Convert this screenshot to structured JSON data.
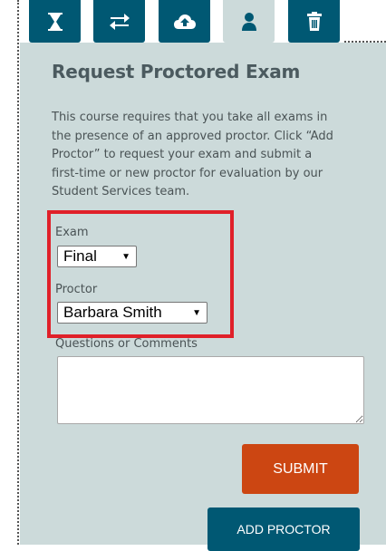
{
  "tabs": [
    {
      "icon": "hourglass-icon",
      "active": false
    },
    {
      "icon": "swap-arrows-icon",
      "active": false
    },
    {
      "icon": "cloud-upload-icon",
      "active": false
    },
    {
      "icon": "user-icon",
      "active": true
    },
    {
      "icon": "trash-icon",
      "active": false
    }
  ],
  "form": {
    "title": "Request Proctored Exam",
    "description": "This course requires that you take all exams in the presence of an approved proctor. Click “Add Proctor” to request your exam and submit a first-time or new proctor for evaluation by our Student Services team.",
    "exam_label": "Exam",
    "exam_value": "Final",
    "proctor_label": "Proctor",
    "proctor_value": "Barbara Smith",
    "comments_label": "Questions or Comments",
    "comments_value": ""
  },
  "buttons": {
    "submit_label": "SUBMIT",
    "add_proctor_label": "ADD PROCTOR"
  },
  "colors": {
    "panel_bg": "#ccdada",
    "tab_bg": "#005873",
    "submit_bg": "#cc4612",
    "highlight": "#e02029"
  }
}
